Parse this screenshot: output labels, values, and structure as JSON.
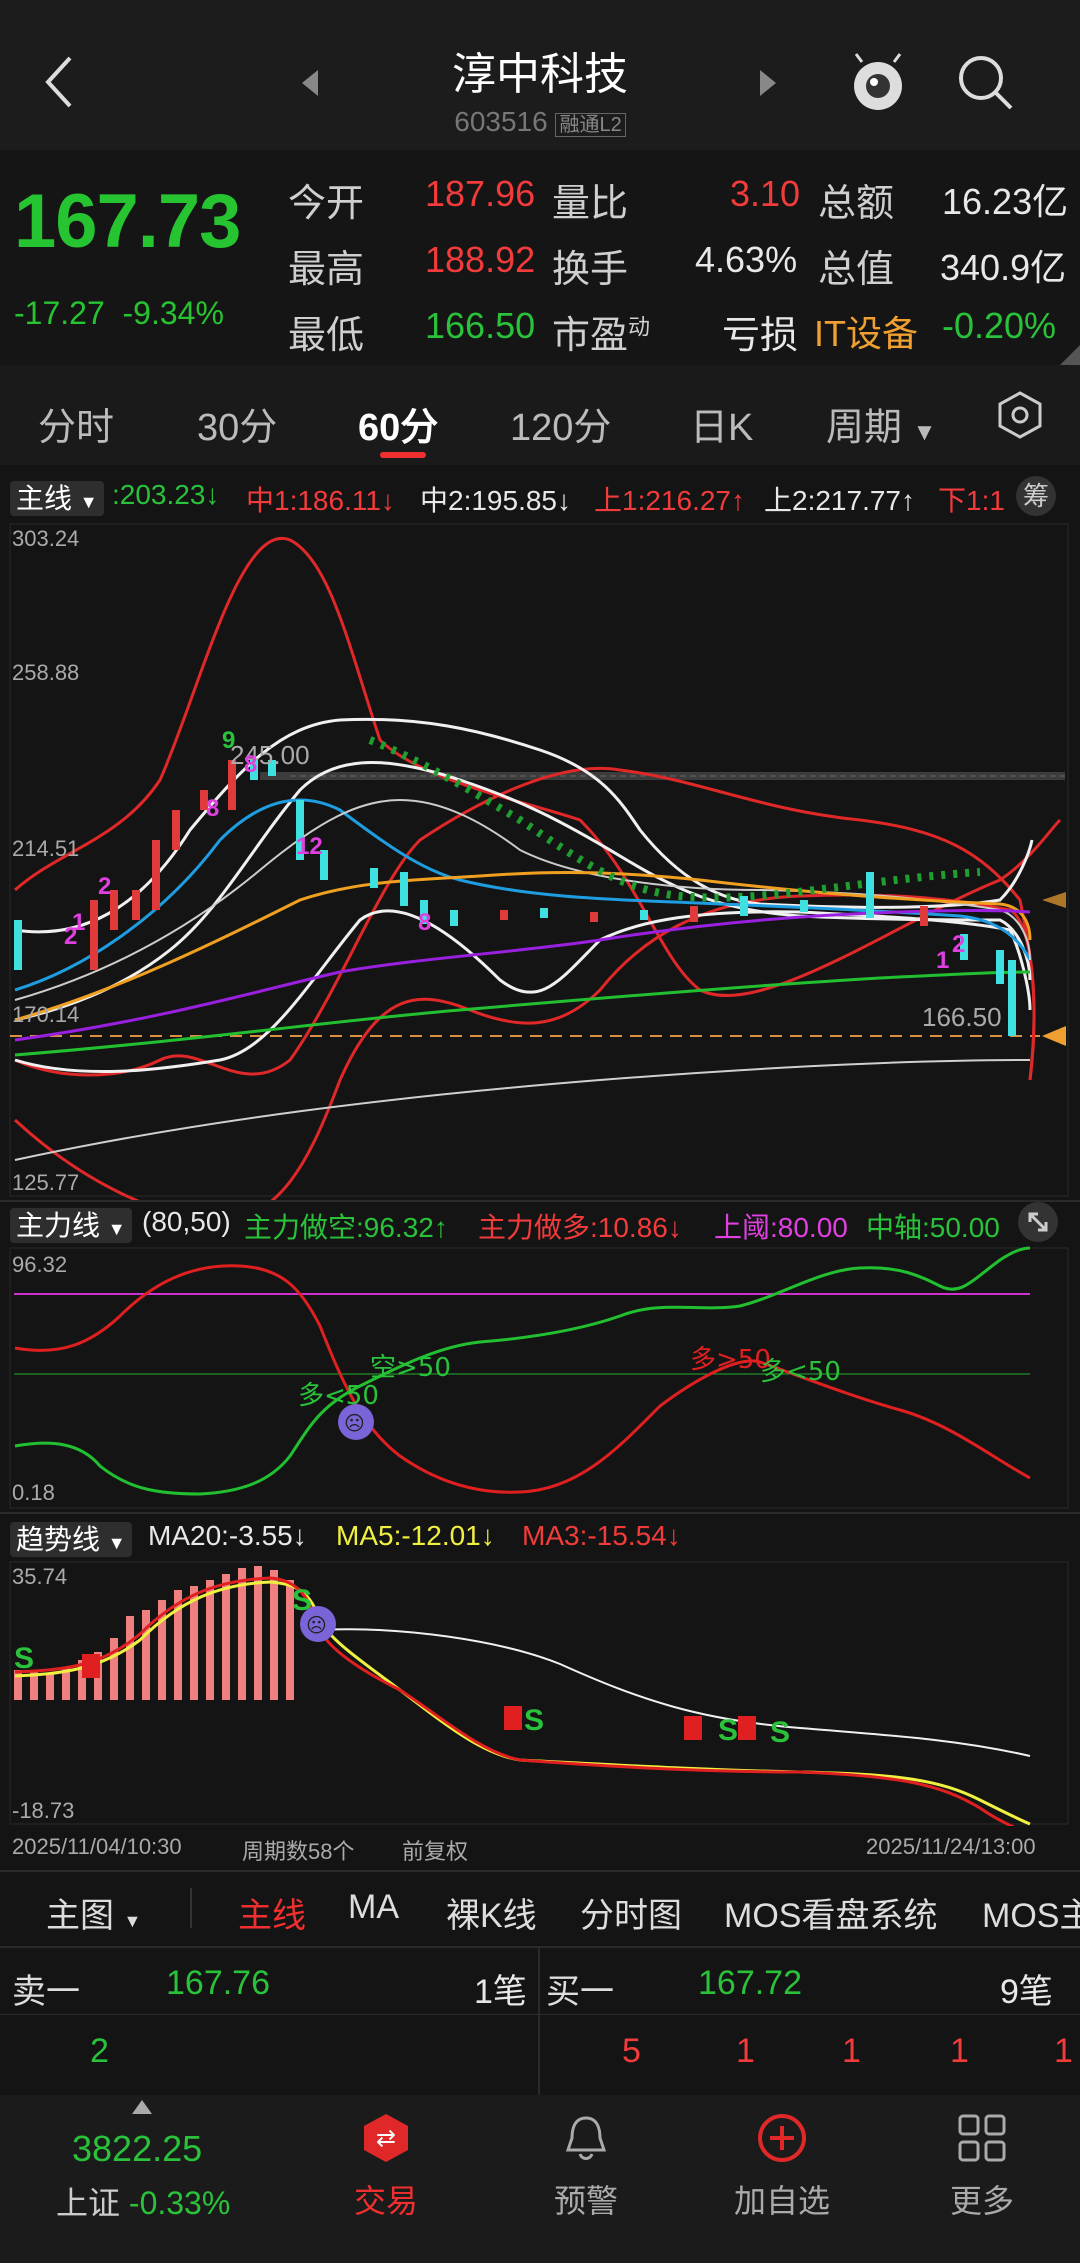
{
  "header": {
    "title": "淳中科技",
    "code": "603516",
    "badges": "融通L2"
  },
  "quote": {
    "price": "167.73",
    "change": "-17.27",
    "change_pct": "-9.34%",
    "row1": {
      "l1": "今开",
      "v1": "187.96",
      "l2": "量比",
      "v2": "3.10",
      "l3": "总额",
      "v3": "16.23亿"
    },
    "row2": {
      "l1": "最高",
      "v1": "188.92",
      "l2": "换手",
      "v2": "4.63%",
      "l3": "总值",
      "v3": "340.9亿"
    },
    "row3": {
      "l1": "最低",
      "v1": "166.50",
      "l2": "市盈",
      "v2sup": "动",
      "v2": "亏损",
      "l3": "IT设备",
      "v3": "-0.20%"
    }
  },
  "tabs": [
    "分时",
    "30分",
    "60分",
    "120分",
    "日K",
    "周期"
  ],
  "active_tab": "60分",
  "main_chart": {
    "selector": "主线",
    "params": ":203.23↓",
    "mid1": "中1:186.11↓",
    "mid2": "中2:195.85↓",
    "up1": "上1:216.27↑",
    "up2": "上2:217.77↑",
    "down1": "下1:1",
    "chip_btn": "筹",
    "y_labels": [
      "303.24",
      "258.88",
      "214.51",
      "170.14",
      "125.77"
    ],
    "hi_mark": "245.00",
    "lo_mark": "166.50",
    "signals": [
      "9",
      "8",
      "8",
      "2",
      "2",
      "1",
      "8",
      "12",
      "1",
      "2"
    ]
  },
  "force_panel": {
    "selector": "主力线",
    "params": "(80,50)",
    "short": "主力做空:96.32↑",
    "long": "主力做多:10.86↓",
    "upper": "上阈:80.00",
    "mid": "中轴:50.00",
    "y_top": "96.32",
    "y_bot": "0.18",
    "notes": [
      "空>50",
      "多<50",
      "多>50",
      "多<50"
    ]
  },
  "trend_panel": {
    "selector": "趋势线",
    "ma20": "MA20:-3.55↓",
    "ma5": "MA5:-12.01↓",
    "ma3": "MA3:-15.54↓",
    "y_top": "35.74",
    "y_bot": "-18.73"
  },
  "footer_axis": {
    "start": "2025/11/04/10:30",
    "count": "周期数58个",
    "adjust": "前复权",
    "end": "2025/11/24/13:00"
  },
  "overlay_bar": [
    "主图",
    "主线",
    "MA",
    "裸K线",
    "分时图",
    "MOS看盘系统",
    "MOS主"
  ],
  "orderbook": {
    "sell_label": "卖一",
    "sell_price": "167.76",
    "sell_lots": "1笔",
    "buy_label": "买一",
    "buy_price": "167.72",
    "buy_lots": "9笔",
    "sell_qty": [
      "2"
    ],
    "buy_qty": [
      "5",
      "1",
      "1",
      "1",
      "1"
    ]
  },
  "bottom_nav": {
    "index_value": "3822.25",
    "index_name": "上证",
    "index_pct": "-0.33%",
    "items": [
      "交易",
      "预警",
      "加自选",
      "更多"
    ]
  }
}
